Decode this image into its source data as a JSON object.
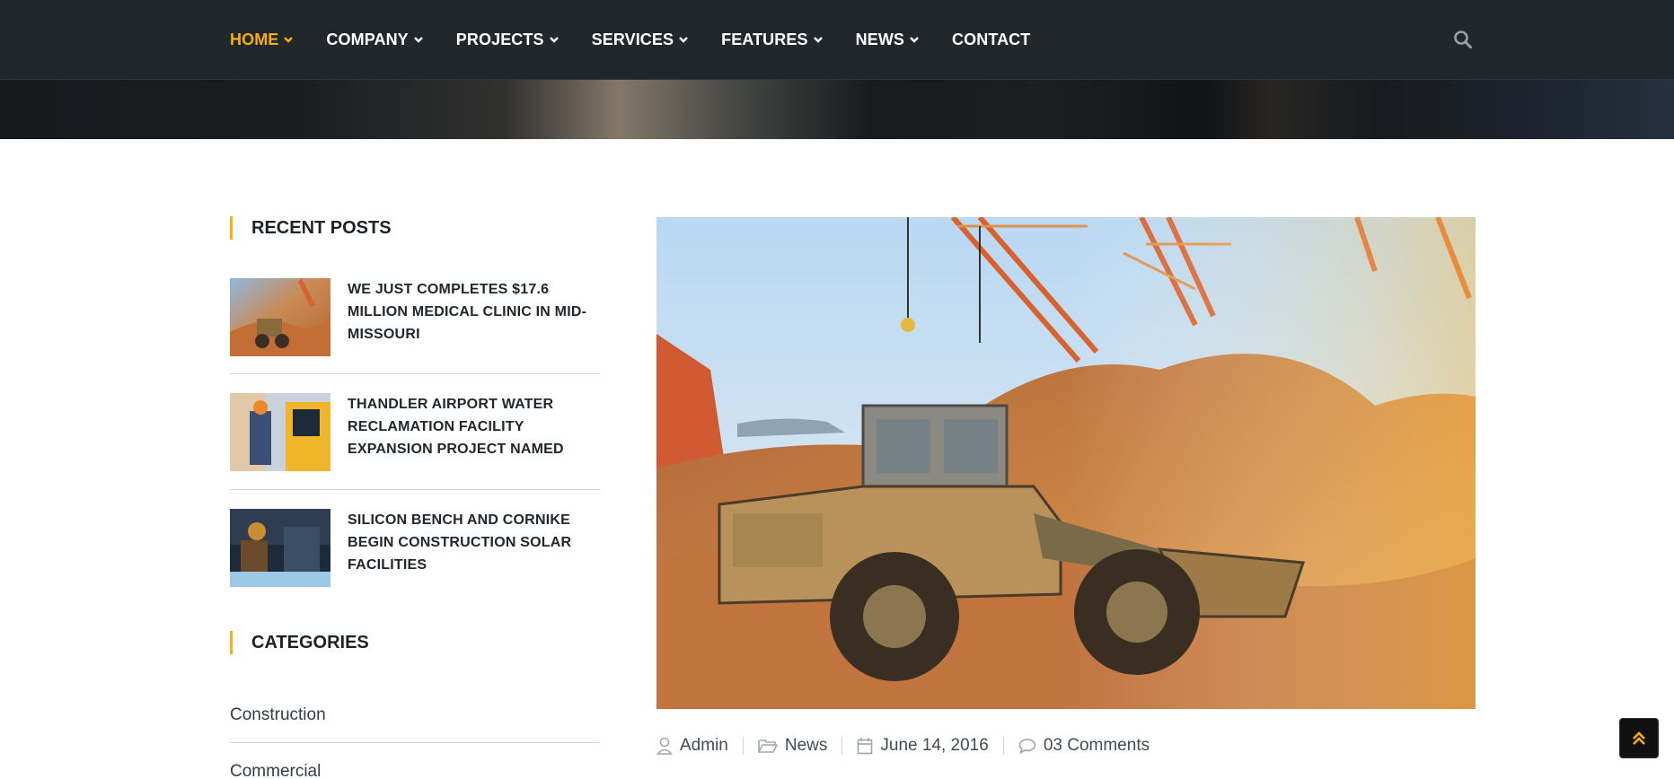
{
  "nav": {
    "items": [
      {
        "label": "HOME",
        "has_dropdown": true,
        "active": true
      },
      {
        "label": "COMPANY",
        "has_dropdown": true,
        "active": false
      },
      {
        "label": "PROJECTS",
        "has_dropdown": true,
        "active": false
      },
      {
        "label": "SERVICES",
        "has_dropdown": true,
        "active": false
      },
      {
        "label": "FEATURES",
        "has_dropdown": true,
        "active": false
      },
      {
        "label": "NEWS",
        "has_dropdown": true,
        "active": false
      },
      {
        "label": "CONTACT",
        "has_dropdown": false,
        "active": false
      }
    ],
    "search_icon": "search-icon"
  },
  "sidebar": {
    "recent_posts_title": "RECENT POSTS",
    "recent_posts": [
      {
        "title": "WE JUST COMPLETES $17.6 MILLION MEDICAL CLINIC IN MID-MISSOURI"
      },
      {
        "title": "THANDLER AIRPORT WATER RECLAMATION FACILITY EXPANSION PROJECT NAMED"
      },
      {
        "title": "SILICON BENCH AND CORNIKE BEGIN CONSTRUCTION SOLAR FACILITIES"
      }
    ],
    "categories_title": "CATEGORIES",
    "categories": [
      "Construction",
      "Commercial"
    ]
  },
  "post_meta": {
    "author": "Admin",
    "category": "News",
    "date": "June 14, 2016",
    "comments": "03 Comments"
  },
  "colors": {
    "accent": "#f5b00a",
    "nav_bg": "#22272c",
    "heading": "#1d2127"
  },
  "back_to_top_icon": "double-chevron-up-icon"
}
